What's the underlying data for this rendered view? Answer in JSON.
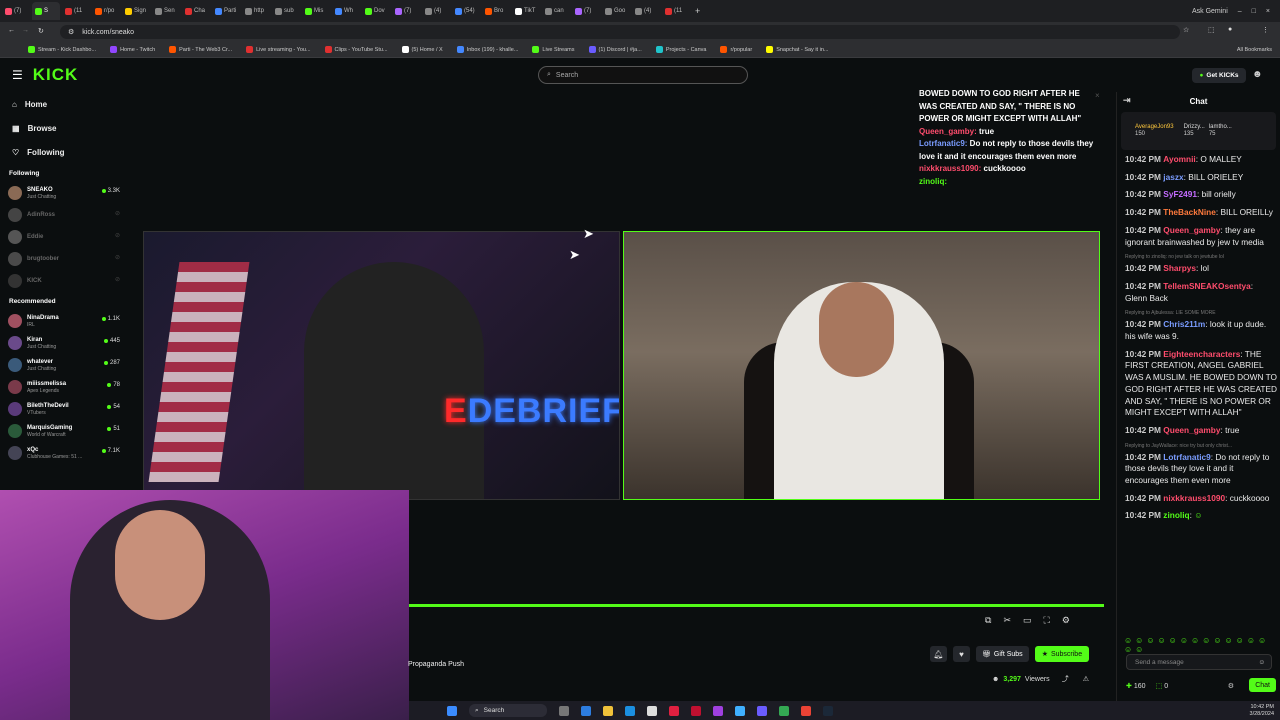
{
  "browser": {
    "tabs": [
      {
        "label": "(7)",
        "color": "#ff4d6d"
      },
      {
        "label": "S",
        "color": "#53fc18",
        "active": true
      },
      {
        "label": "(11",
        "color": "#e03030"
      },
      {
        "label": "r/po",
        "color": "#ff5500"
      },
      {
        "label": "Sign",
        "color": "#ffcc00"
      },
      {
        "label": "Sen",
        "color": "#888888"
      },
      {
        "label": "Cha",
        "color": "#e03030"
      },
      {
        "label": "Parti",
        "color": "#4488ff"
      },
      {
        "label": "http",
        "color": "#888888"
      },
      {
        "label": "sub",
        "color": "#888888"
      },
      {
        "label": "Mis",
        "color": "#53fc18"
      },
      {
        "label": "Wh",
        "color": "#4488ff"
      },
      {
        "label": "Dov",
        "color": "#53fc18"
      },
      {
        "label": "(7)",
        "color": "#aa66ff"
      },
      {
        "label": "(4)",
        "color": "#888888"
      },
      {
        "label": "(54)",
        "color": "#4488ff"
      },
      {
        "label": "Bro",
        "color": "#ff5500"
      },
      {
        "label": "TikT",
        "color": "#ffffff"
      },
      {
        "label": "can",
        "color": "#888888"
      },
      {
        "label": "(7)",
        "color": "#aa66ff"
      },
      {
        "label": "Goo",
        "color": "#888888"
      },
      {
        "label": "(4)",
        "color": "#888888"
      },
      {
        "label": "(11",
        "color": "#e03030"
      }
    ],
    "ask_gemini": "Ask Gemini",
    "url": "kick.com/sneako",
    "bookmarks": [
      "Stream - Kick Dashbo...",
      "Home - Twitch",
      "Parti - The Web3 Cr...",
      "Live streaming - You...",
      "Clips - YouTube Stu...",
      "(5) Home / X",
      "Inbox (199) - khalle...",
      "Live Streams",
      "(1) Discord | #ja...",
      "Projects - Canva",
      "r/popular",
      "Snapchat - Say it in..."
    ],
    "all_bookmarks": "All Bookmarks"
  },
  "header": {
    "logo": "KICK",
    "search_placeholder": "Search",
    "get_kicks": "Get KICKs"
  },
  "sidebar": {
    "nav": [
      {
        "label": "Home",
        "icon": "home-icon"
      },
      {
        "label": "Browse",
        "icon": "browse-icon"
      },
      {
        "label": "Following",
        "icon": "heart-icon"
      }
    ],
    "following_title": "Following",
    "following": [
      {
        "name": "SNEAKO",
        "sub": "Just Chatting",
        "count": "3.3K",
        "live": true
      },
      {
        "name": "AdinRoss",
        "sub": "",
        "count": "",
        "live": false
      },
      {
        "name": "Eddie",
        "sub": "",
        "count": "",
        "live": false
      },
      {
        "name": "brugtoober",
        "sub": "",
        "count": "",
        "live": false
      },
      {
        "name": "KICK",
        "sub": "",
        "count": "",
        "live": false
      }
    ],
    "recommended_title": "Recommended",
    "recommended": [
      {
        "name": "NinaDrama",
        "sub": "IRL",
        "count": "1.1K"
      },
      {
        "name": "Kiran",
        "sub": "Just Chatting",
        "count": "445"
      },
      {
        "name": "whatever",
        "sub": "Just Chatting",
        "count": "287"
      },
      {
        "name": "miiissmelissa",
        "sub": "Apex Legends",
        "count": "78"
      },
      {
        "name": "BilethTheDevil",
        "sub": "VTubers",
        "count": "54"
      },
      {
        "name": "MarquisGaming",
        "sub": "World of Warcraft",
        "count": "51"
      },
      {
        "name": "xQc",
        "sub": "Clubhouse Games: 51 ...",
        "count": "7.1K"
      }
    ]
  },
  "video": {
    "left_overlay_text": "DEBRIEF",
    "left_overlay_e": "E"
  },
  "overlay_chat": [
    {
      "user": "",
      "text": "BOWED DOWN TO GOD RIGHT AFTER HE WAS CREATED AND SAY, \" THERE IS NO POWER OR MIGHT EXCEPT WITH ALLAH\""
    },
    {
      "user": "Queen_gamby:",
      "text": " true"
    },
    {
      "user": "Lotrfanatic9:",
      "text": " Do not reply to those devils they love it and it encourages them even more"
    },
    {
      "user": "nixkkrauss1090:",
      "text": " cuckkoooo"
    },
    {
      "user": "zinoliq:",
      "text": ""
    }
  ],
  "player": {
    "stream_title": "Propaganda Push",
    "gift_subs": "Gift Subs",
    "subscribe": "Subscribe",
    "viewers_count": "3,297",
    "viewers_label": "Viewers"
  },
  "chat": {
    "title": "Chat",
    "pinned": [
      {
        "user": "AverageJon93",
        "value": "150"
      },
      {
        "user": "Drizzy...",
        "value": "135"
      },
      {
        "user": "lamtho...",
        "value": "75"
      }
    ],
    "messages": [
      {
        "time": "10:42 PM",
        "user": "Ayomnii",
        "color": "#ff4d6d",
        "text": "O MALLEY",
        "reply": ""
      },
      {
        "time": "10:42 PM",
        "user": "jaszx",
        "color": "#7a9cff",
        "text": "BILL ORIELEY",
        "reply": ""
      },
      {
        "time": "10:42 PM",
        "user": "SyF2491",
        "color": "#c46cff",
        "text": "bill orielly",
        "reply": ""
      },
      {
        "time": "10:42 PM",
        "user": "TheBackNine",
        "color": "#ff7a3d",
        "text": "BILL OREILLy",
        "reply": ""
      },
      {
        "time": "10:42 PM",
        "user": "Queen_gamby",
        "color": "#ff4d6d",
        "text": "they are ignorant brainwashed by jew tv media",
        "reply": ""
      },
      {
        "time": "10:42 PM",
        "user": "Sharpys",
        "color": "#ff4d6d",
        "text": "lol",
        "reply": "Replying to zinoliq: no jew talk on jewtube lol"
      },
      {
        "time": "10:42 PM",
        "user": "TellemSNEAKOsentya",
        "color": "#ff4d6d",
        "text": "Glenn Back",
        "reply": ""
      },
      {
        "time": "10:42 PM",
        "user": "Chris211m",
        "color": "#7a9cff",
        "text": "look it up dude. his wife was 9.",
        "reply": "Replying to Ajbulessa: LIE SOME MORE"
      },
      {
        "time": "10:42 PM",
        "user": "Eighteencharacters",
        "color": "#ff4d6d",
        "text": "THE FIRST CREATION, ANGEL GABRIEL WAS A MUSLIM. HE BOWED DOWN TO GOD RIGHT AFTER HE WAS CREATED AND SAY, \" THERE IS NO POWER OR MIGHT EXCEPT WITH ALLAH\"",
        "reply": ""
      },
      {
        "time": "10:42 PM",
        "user": "Queen_gamby",
        "color": "#ff4d6d",
        "text": "true",
        "reply": ""
      },
      {
        "time": "10:42 PM",
        "user": "Lotrfanatic9",
        "color": "#7a9cff",
        "text": "Do not reply to those devils they love it and it encourages them even more",
        "reply": "Replying to JayWallace: nice try but only christ..."
      },
      {
        "time": "10:42 PM",
        "user": "nixkkrauss1090",
        "color": "#ff4d6d",
        "text": "cuckkoooo",
        "reply": ""
      },
      {
        "time": "10:42 PM",
        "user": "zinoliq",
        "color": "#53fc18",
        "text": "",
        "reply": ""
      }
    ],
    "input_placeholder": "Send a message",
    "points": "160",
    "kicks": "0",
    "send_label": "Chat"
  },
  "taskbar": {
    "search": "Search",
    "time": "10:42 PM",
    "date": "3/28/2024"
  }
}
